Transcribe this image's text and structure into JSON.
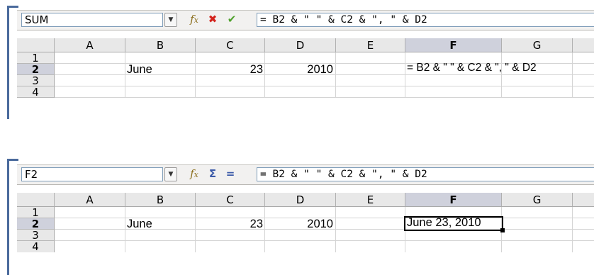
{
  "top_panel": {
    "name_box": "SUM",
    "formula": "= B2 & \" \" & C2 & \", \" & D2",
    "toolbar_icons": [
      "function-wizard-icon",
      "cancel-icon",
      "accept-icon"
    ],
    "columns": [
      "A",
      "B",
      "C",
      "D",
      "E",
      "F",
      "G"
    ],
    "rows": [
      "1",
      "2",
      "3",
      "4"
    ],
    "selected_column": "F",
    "selected_row": "2",
    "cells": {
      "B2": "June",
      "C2": "23",
      "D2": "2010",
      "F2": "= B2 & \" \" & C2 & \", \" & D2"
    }
  },
  "bottom_panel": {
    "name_box": "F2",
    "formula": "= B2 & \" \" & C2 & \", \" & D2",
    "toolbar_icons": [
      "function-wizard-icon",
      "sum-icon",
      "function-icon"
    ],
    "sum_symbol": "Σ",
    "equals_symbol": "=",
    "columns": [
      "A",
      "B",
      "C",
      "D",
      "E",
      "F",
      "G"
    ],
    "rows": [
      "1",
      "2",
      "3",
      "4"
    ],
    "selected_column": "F",
    "selected_row": "2",
    "cells": {
      "B2": "June",
      "C2": "23",
      "D2": "2010",
      "F2": "June 23, 2010"
    }
  },
  "colors": {
    "accent": "#4a6a9c",
    "header_bg": "#e8e8e8",
    "selected_header_bg": "#cfd1dc",
    "cancel_red": "#d3231d",
    "accept_green": "#4fa12c"
  }
}
